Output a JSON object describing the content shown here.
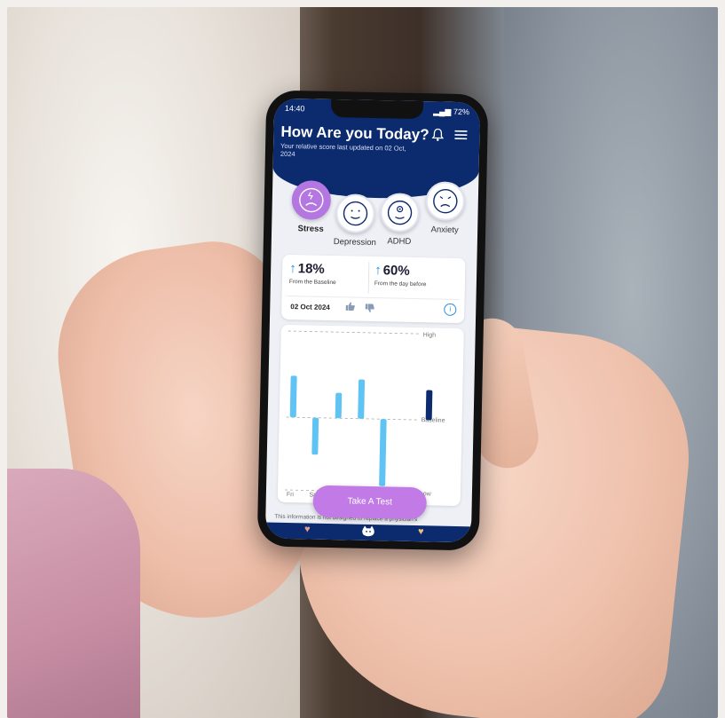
{
  "status": {
    "time": "14:40",
    "battery": "72%"
  },
  "header": {
    "title": "How Are you Today?",
    "subtitle": "Your relative score last updated on 02 Oct, 2024",
    "bell_icon": "bell-icon",
    "menu_icon": "hamburger-menu-icon"
  },
  "moods": [
    {
      "label": "Stress",
      "active": true,
      "icon": "stressed-face-icon"
    },
    {
      "label": "Depression",
      "active": false,
      "icon": "neutral-face-icon"
    },
    {
      "label": "ADHD",
      "active": false,
      "icon": "dizzy-face-icon"
    },
    {
      "label": "Anxiety",
      "active": false,
      "icon": "sad-face-icon"
    }
  ],
  "stats": {
    "baseline_pct": "18%",
    "baseline_desc": "From the Baseline",
    "daybefore_pct": "60%",
    "daybefore_desc": "From the day before",
    "date": "02 Oct 2024",
    "like_icon": "thumbs-up-icon",
    "dislike_icon": "thumbs-down-icon",
    "info_icon": "info-icon"
  },
  "chart_data": {
    "type": "bar",
    "categories": [
      "Fri",
      "Sat",
      "",
      "",
      "",
      "",
      ""
    ],
    "values": [
      0.9,
      -0.8,
      0.55,
      0.85,
      -1.45,
      0,
      0.65
    ],
    "highlight_index": 6,
    "ylim": [
      -1.6,
      2.0
    ],
    "reference_lines": [
      "High",
      "Baseline",
      "Low"
    ],
    "colors": {
      "bar": "#5fc3f3",
      "highlight": "#0c2a6e",
      "ref": "#aaaaaa"
    }
  },
  "cta": {
    "label": "Take A Test"
  },
  "disclaimer": "This information is not designed to replace a physician's",
  "nav": {
    "left_icon": "heart-icon",
    "center_icon": "mascot-icon",
    "right_icon": "heart-icon"
  },
  "colors": {
    "brand": "#0c2a6e",
    "accent": "#c17ae6",
    "arrow": "#2a8de0"
  }
}
